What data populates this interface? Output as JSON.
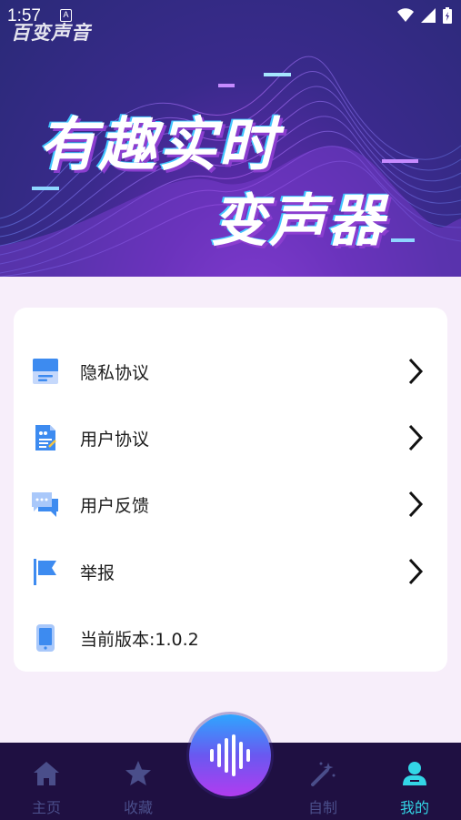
{
  "status_bar": {
    "time": "1:57",
    "notification_glyph": "A"
  },
  "banner": {
    "app_name": "百变声音",
    "headline_line1": "有趣实时",
    "headline_line2": "变声器"
  },
  "menu": {
    "items": [
      {
        "label": "隐私协议",
        "icon": "save-doc-icon",
        "has_chevron": true
      },
      {
        "label": "用户协议",
        "icon": "contract-doc-icon",
        "has_chevron": true
      },
      {
        "label": "用户反馈",
        "icon": "chat-bubbles-icon",
        "has_chevron": true
      },
      {
        "label": "举报",
        "icon": "flag-icon",
        "has_chevron": true
      },
      {
        "label": "当前版本:1.0.2",
        "icon": "phone-icon",
        "has_chevron": false
      }
    ]
  },
  "bottom_nav": {
    "items": [
      {
        "label": "主页",
        "icon": "home-icon",
        "active": false
      },
      {
        "label": "收藏",
        "icon": "star-icon",
        "active": false
      },
      {
        "label": "自制",
        "icon": "magic-wand-icon",
        "active": false
      },
      {
        "label": "我的",
        "icon": "user-icon",
        "active": true
      }
    ],
    "center_button_icon": "sound-wave-icon"
  },
  "colors": {
    "accent_active": "#33d6e6",
    "nav_background": "#1f1042",
    "nav_inactive": "#4a4e8a",
    "page_background": "#f7eefa",
    "icon_blue": "#3d8bf0"
  }
}
